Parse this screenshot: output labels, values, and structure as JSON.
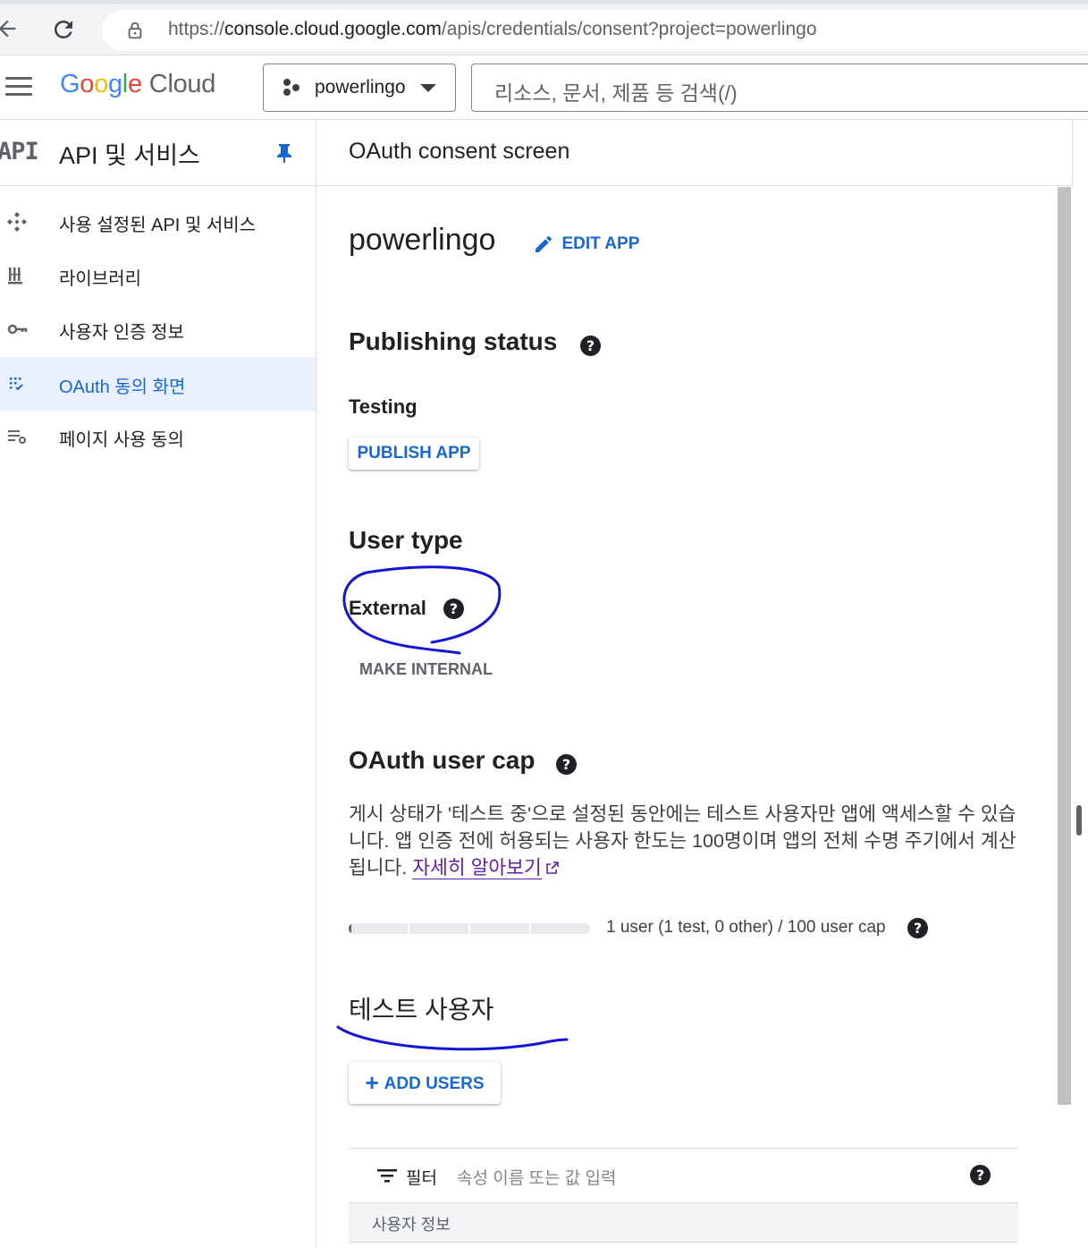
{
  "browser": {
    "url_scheme": "https://",
    "url_host": "console.cloud.google.com",
    "url_path": "/apis/credentials/consent?project=powerlingo"
  },
  "header": {
    "logo_google": "Google",
    "logo_cloud": "Cloud",
    "project_name": "powerlingo",
    "search_placeholder": "리소스, 문서, 제품 등 검색(/)"
  },
  "sidebar": {
    "glyph": "API",
    "title": "API 및 서비스",
    "items": [
      {
        "label": "사용 설정된 API 및 서비스",
        "icon": "diamond-dots-icon",
        "active": false
      },
      {
        "label": "라이브러리",
        "icon": "library-icon",
        "active": false
      },
      {
        "label": "사용자 인증 정보",
        "icon": "key-icon",
        "active": false
      },
      {
        "label": "OAuth 동의 화면",
        "icon": "consent-grid-icon",
        "active": true
      },
      {
        "label": "페이지 사용 동의",
        "icon": "settings-list-icon",
        "active": false
      }
    ]
  },
  "main": {
    "page_title": "OAuth consent screen",
    "app_name": "powerlingo",
    "edit_app_label": "EDIT APP",
    "publishing_status": {
      "title": "Publishing status",
      "value": "Testing",
      "button": "PUBLISH APP"
    },
    "user_type": {
      "title": "User type",
      "value": "External",
      "button": "MAKE INTERNAL"
    },
    "user_cap": {
      "title": "OAuth user cap",
      "description": "게시 상태가 '테스트 중'으로 설정된 동안에는 테스트 사용자만 앱에 액세스할 수 있습니다. 앱 인증 전에 허용되는 사용자 한도는 100명이며 앱의 전체 수명 주기에서 계산됩니다. ",
      "learn_more": "자세히 알아보기",
      "usage_text": "1 user (1 test, 0 other) / 100 user cap",
      "users": 1,
      "cap": 100
    },
    "test_users": {
      "title": "테스트 사용자",
      "add_button": "ADD USERS",
      "filter_label": "필터",
      "filter_placeholder": "속성 이름 또는 값 입력",
      "column_header": "사용자 정보"
    }
  },
  "colors": {
    "accent": "#1967d2",
    "active_bg": "#e8f0fe",
    "link_visited": "#681da8",
    "annotation_ink": "#1414d4"
  }
}
